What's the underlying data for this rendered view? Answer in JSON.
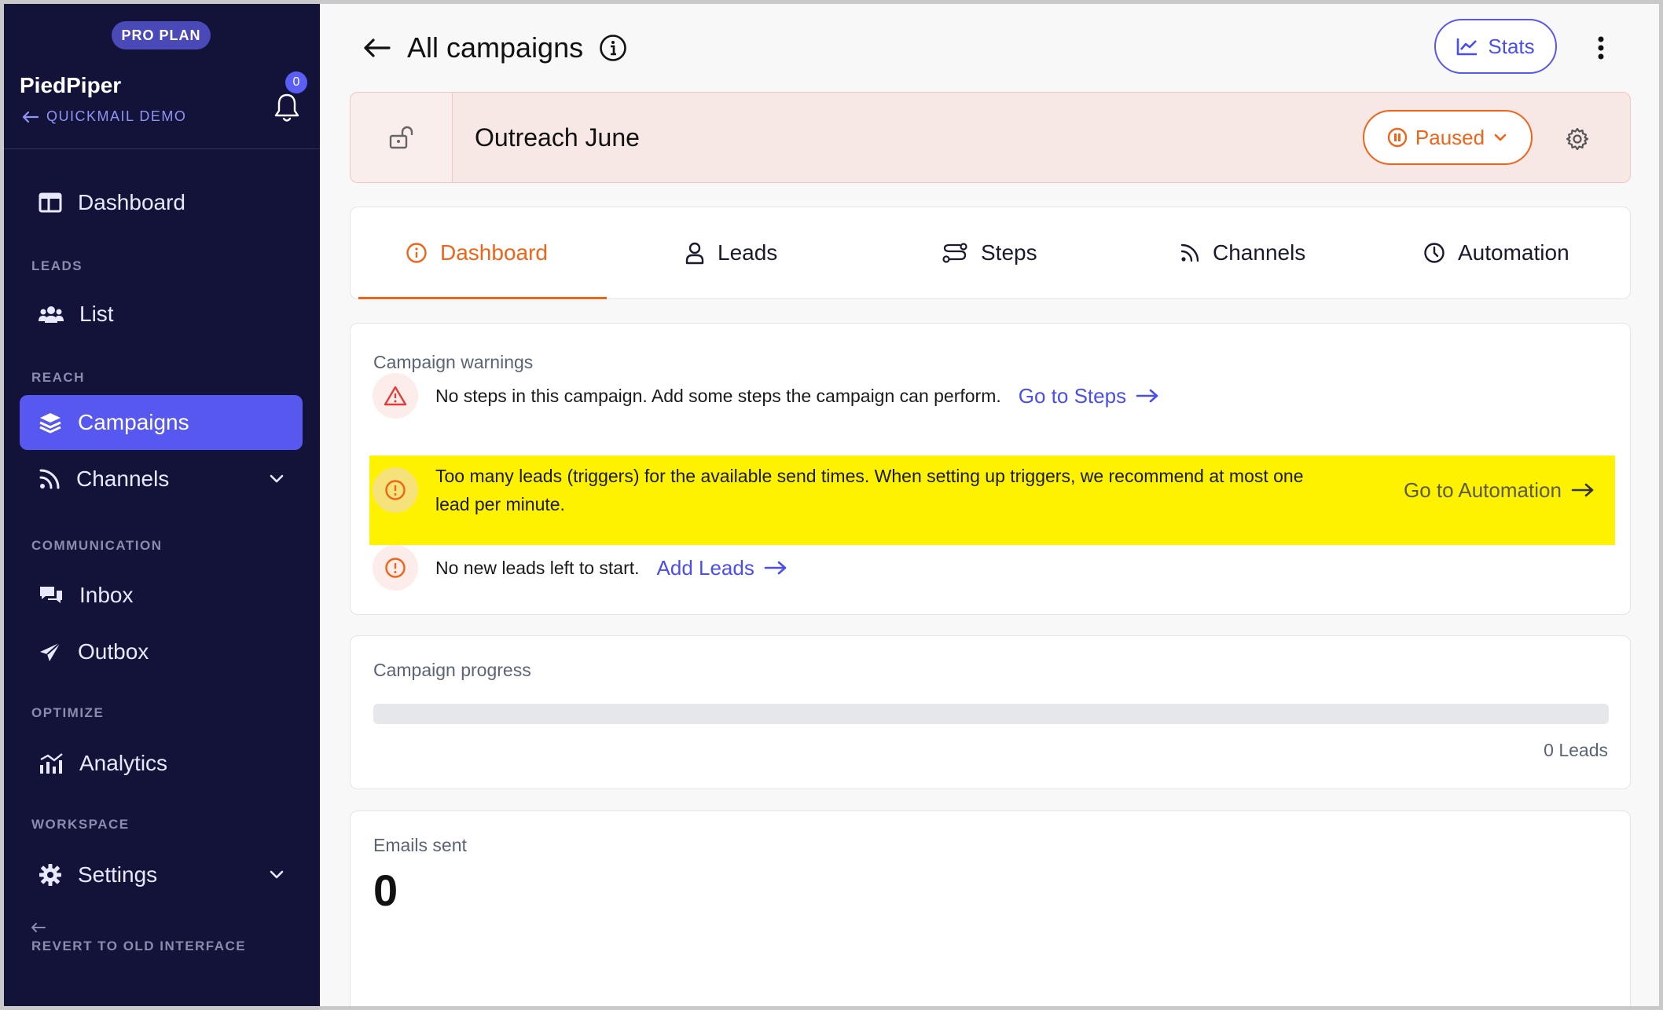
{
  "sidebar": {
    "plan_badge": "PRO PLAN",
    "org_name": "PiedPiper",
    "org_sub": "QUICKMAIL DEMO",
    "notification_count": "0",
    "nav": {
      "dashboard": "Dashboard",
      "section_leads": "LEADS",
      "list": "List",
      "section_reach": "REACH",
      "campaigns": "Campaigns",
      "channels": "Channels",
      "section_communication": "COMMUNICATION",
      "inbox": "Inbox",
      "outbox": "Outbox",
      "section_optimize": "OPTIMIZE",
      "analytics": "Analytics",
      "section_workspace": "WORKSPACE",
      "settings": "Settings"
    },
    "revert_label": "REVERT TO OLD INTERFACE"
  },
  "header": {
    "title": "All campaigns",
    "stats_label": "Stats"
  },
  "campaign": {
    "name": "Outreach June",
    "status": "Paused"
  },
  "tabs": [
    {
      "label": "Dashboard",
      "active": true
    },
    {
      "label": "Leads",
      "active": false
    },
    {
      "label": "Steps",
      "active": false
    },
    {
      "label": "Channels",
      "active": false
    },
    {
      "label": "Automation",
      "active": false
    }
  ],
  "warnings": {
    "title": "Campaign warnings",
    "items": [
      {
        "text": "No steps in this campaign. Add some steps the campaign can perform.",
        "link": "Go to Steps",
        "severity": "error"
      },
      {
        "text_line1": "Too many leads (triggers) for the available send times. When setting up triggers, we recommend at most one",
        "text_line2": "lead per minute.",
        "link": "Go to Automation",
        "severity": "warning",
        "highlighted": true
      },
      {
        "text": "No new leads left to start.",
        "link": "Add Leads",
        "severity": "warning"
      }
    ]
  },
  "progress": {
    "title": "Campaign progress",
    "fraction": 0,
    "leads_label": "0 Leads"
  },
  "emails": {
    "title": "Emails sent",
    "value": "0"
  },
  "colors": {
    "sidebar_bg": "#13133a",
    "accent": "#5658f0",
    "paused_orange": "#f06418",
    "highlight_yellow": "#fff200"
  }
}
